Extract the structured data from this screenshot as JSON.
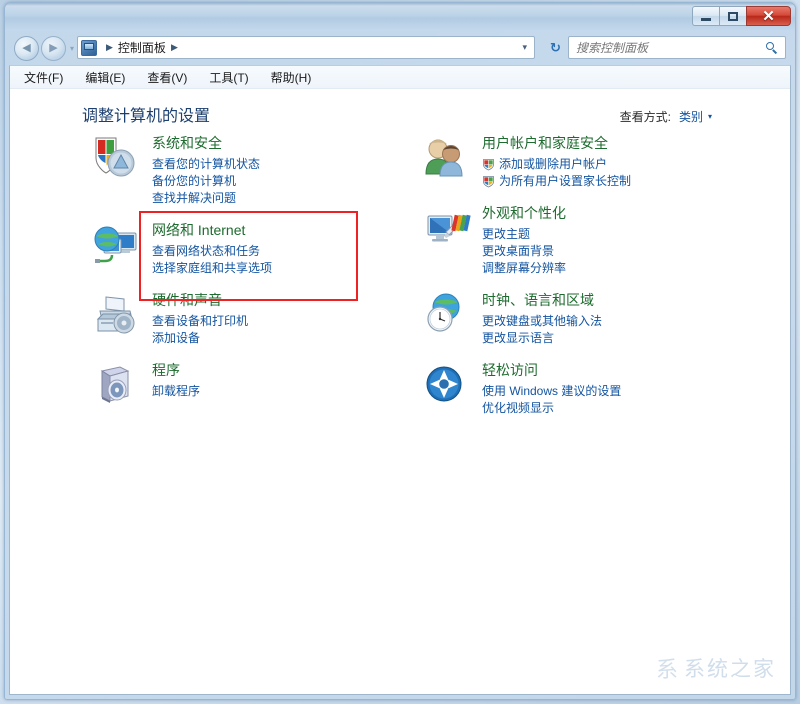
{
  "window": {
    "controls": {
      "minimize": "–",
      "maximize": "❐",
      "close": "✕"
    }
  },
  "nav": {
    "back": "◀",
    "forward": "▶",
    "history_caret": "▾",
    "breadcrumb_sep1": "▶",
    "breadcrumb_root": "控制面板",
    "breadcrumb_sep2": "▶",
    "address_caret": "▾",
    "refresh": "↻",
    "search_placeholder": "搜索控制面板"
  },
  "menu": {
    "items": [
      {
        "label": "文件(F)"
      },
      {
        "label": "编辑(E)"
      },
      {
        "label": "查看(V)"
      },
      {
        "label": "工具(T)"
      },
      {
        "label": "帮助(H)"
      }
    ]
  },
  "page": {
    "title": "调整计算机的设置",
    "view_by_label": "查看方式:",
    "view_by_value": "类别",
    "view_by_caret": "▾"
  },
  "categories": {
    "left": [
      {
        "icon": "security-shield-icon",
        "title": "系统和安全",
        "links": [
          "查看您的计算机状态",
          "备份您的计算机",
          "查找并解决问题"
        ]
      },
      {
        "icon": "network-globe-icon",
        "title": "网络和 Internet",
        "links": [
          "查看网络状态和任务",
          "选择家庭组和共享选项"
        ]
      },
      {
        "icon": "printer-device-icon",
        "title": "硬件和声音",
        "links": [
          "查看设备和打印机",
          "添加设备"
        ]
      },
      {
        "icon": "programs-disc-icon",
        "title": "程序",
        "links": [
          "卸载程序"
        ]
      }
    ],
    "right": [
      {
        "icon": "user-accounts-icon",
        "title": "用户帐户和家庭安全",
        "links": [
          "添加或删除用户帐户",
          "为所有用户设置家长控制"
        ],
        "shielded": [
          true,
          true
        ]
      },
      {
        "icon": "appearance-monitor-icon",
        "title": "外观和个性化",
        "links": [
          "更改主题",
          "更改桌面背景",
          "调整屏幕分辨率"
        ]
      },
      {
        "icon": "clock-region-icon",
        "title": "时钟、语言和区域",
        "links": [
          "更改键盘或其他输入法",
          "更改显示语言"
        ]
      },
      {
        "icon": "ease-of-access-icon",
        "title": "轻松访问",
        "links": [
          "使用 Windows 建议的设置",
          "优化视频显示"
        ]
      }
    ]
  },
  "annotation": {
    "highlight_target": "系统和安全"
  },
  "watermark": {
    "mark": "系",
    "text": "系统之家"
  },
  "colors": {
    "category_title": "#1d6b2e",
    "link": "#1455a0",
    "page_title": "#1b3f6e",
    "highlight": "#ee2222",
    "close_button": "#b8281a"
  }
}
